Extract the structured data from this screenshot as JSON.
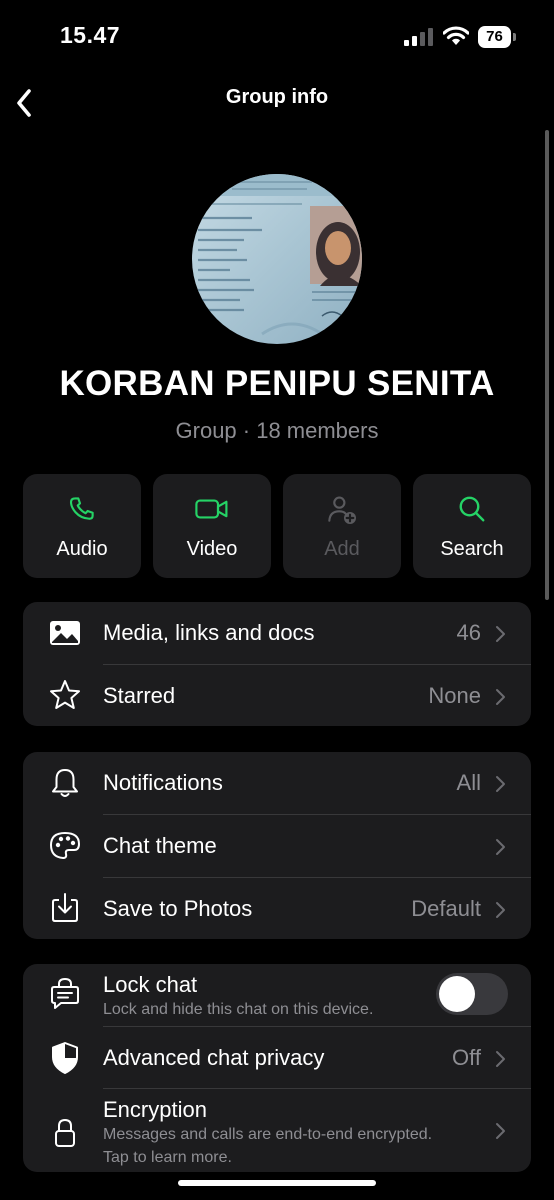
{
  "status": {
    "time": "15.47",
    "battery": "76"
  },
  "nav": {
    "title": "Group info",
    "back_icon": "chevron-left-icon"
  },
  "group": {
    "name": "KORBAN PENIPU SENITA",
    "subtitle": "Group · 18 members"
  },
  "actions": [
    {
      "label": "Audio",
      "icon": "phone-icon",
      "enabled": true
    },
    {
      "label": "Video",
      "icon": "video-camera-icon",
      "enabled": true
    },
    {
      "label": "Add",
      "icon": "add-person-icon",
      "enabled": false
    },
    {
      "label": "Search",
      "icon": "search-icon",
      "enabled": true
    }
  ],
  "section1": [
    {
      "label": "Media, links and docs",
      "value": "46",
      "icon": "image-icon"
    },
    {
      "label": "Starred",
      "value": "None",
      "icon": "star-icon"
    }
  ],
  "section2": [
    {
      "label": "Notifications",
      "value": "All",
      "icon": "bell-icon"
    },
    {
      "label": "Chat theme",
      "value": "",
      "icon": "palette-icon"
    },
    {
      "label": "Save to Photos",
      "value": "Default",
      "icon": "save-download-icon"
    }
  ],
  "section3": {
    "lock": {
      "label": "Lock chat",
      "sub": "Lock and hide this chat on this device.",
      "toggle_on": false
    },
    "privacy": {
      "label": "Advanced chat privacy",
      "value": "Off"
    },
    "encryption": {
      "label": "Encryption",
      "sub1": "Messages and calls are end-to-end encrypted.",
      "sub2": "Tap to learn more."
    }
  },
  "colors": {
    "accent": "#25D366",
    "card": "#1c1c1e",
    "secondary_text": "#8e8e93",
    "background": "#000000"
  }
}
